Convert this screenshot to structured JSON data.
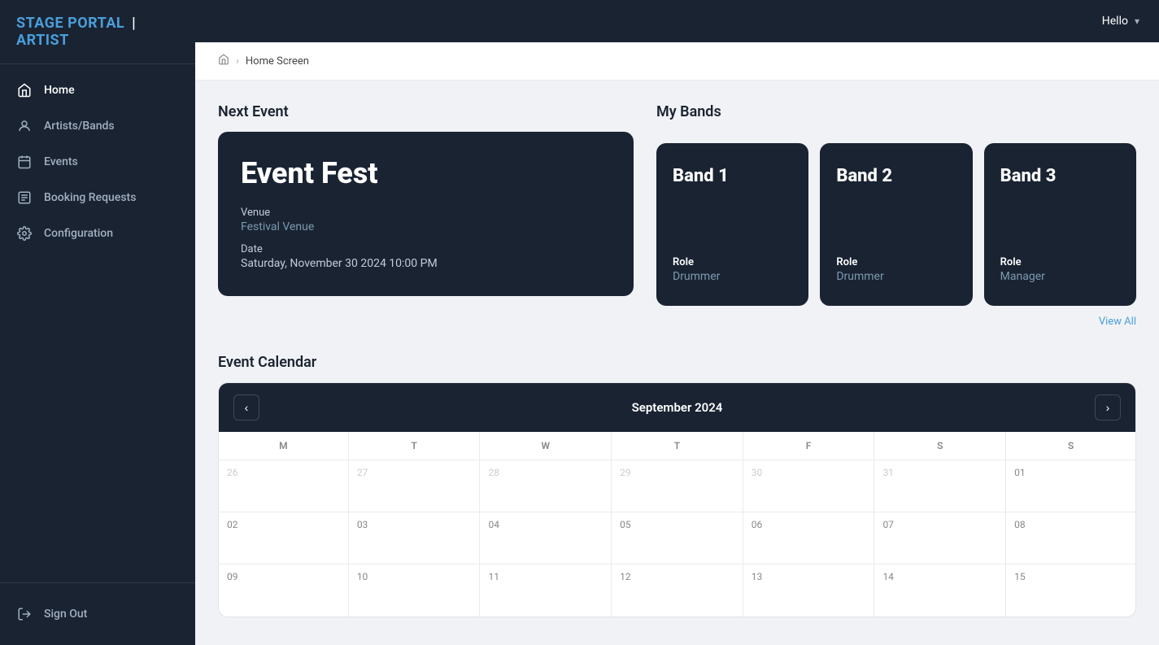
{
  "app": {
    "logo_part1": "STAGE PORTAL",
    "logo_sep": "|",
    "logo_part2": "ARTIST"
  },
  "topbar": {
    "hello_label": "Hello",
    "chevron": "▾"
  },
  "sidebar": {
    "items": [
      {
        "id": "home",
        "label": "Home",
        "icon": "⌂",
        "active": true
      },
      {
        "id": "artists-bands",
        "label": "Artists/Bands",
        "icon": "👤",
        "active": false
      },
      {
        "id": "events",
        "label": "Events",
        "icon": "📋",
        "active": false
      },
      {
        "id": "booking-requests",
        "label": "Booking Requests",
        "icon": "📋",
        "active": false
      },
      {
        "id": "configuration",
        "label": "Configuration",
        "icon": "⚙",
        "active": false
      }
    ],
    "sign_out_label": "Sign Out",
    "sign_out_icon": "↪"
  },
  "breadcrumb": {
    "home_icon": "⌂",
    "separator": "›",
    "current": "Home Screen"
  },
  "next_event": {
    "section_title": "Next Event",
    "card": {
      "title": "Event Fest",
      "venue_label": "Venue",
      "venue_value": "Festival Venue",
      "date_label": "Date",
      "date_value": "Saturday, November 30 2024 10:00 PM"
    }
  },
  "my_bands": {
    "section_title": "My Bands",
    "view_all": "View All",
    "bands": [
      {
        "name": "Band 1",
        "role_label": "Role",
        "role_value": "Drummer"
      },
      {
        "name": "Band 2",
        "role_label": "Role",
        "role_value": "Drummer"
      },
      {
        "name": "Band 3",
        "role_label": "Role",
        "role_value": "Manager"
      }
    ]
  },
  "event_calendar": {
    "section_title": "Event Calendar",
    "month_label": "September 2024",
    "prev_icon": "‹",
    "next_icon": "›",
    "day_headers": [
      "M",
      "T",
      "W",
      "T",
      "F",
      "S",
      "S"
    ],
    "weeks": [
      [
        {
          "num": "26",
          "outside": true
        },
        {
          "num": "27",
          "outside": true
        },
        {
          "num": "28",
          "outside": true
        },
        {
          "num": "29",
          "outside": true
        },
        {
          "num": "30",
          "outside": true
        },
        {
          "num": "31",
          "outside": true
        },
        {
          "num": "01",
          "outside": false
        }
      ],
      [
        {
          "num": "02",
          "outside": false
        },
        {
          "num": "03",
          "outside": false
        },
        {
          "num": "04",
          "outside": false
        },
        {
          "num": "05",
          "outside": false
        },
        {
          "num": "06",
          "outside": false
        },
        {
          "num": "07",
          "outside": false
        },
        {
          "num": "08",
          "outside": false
        }
      ],
      [
        {
          "num": "09",
          "outside": false
        },
        {
          "num": "10",
          "outside": false
        },
        {
          "num": "11",
          "outside": false
        },
        {
          "num": "12",
          "outside": false
        },
        {
          "num": "13",
          "outside": false
        },
        {
          "num": "14",
          "outside": false
        },
        {
          "num": "15",
          "outside": false
        }
      ]
    ]
  }
}
